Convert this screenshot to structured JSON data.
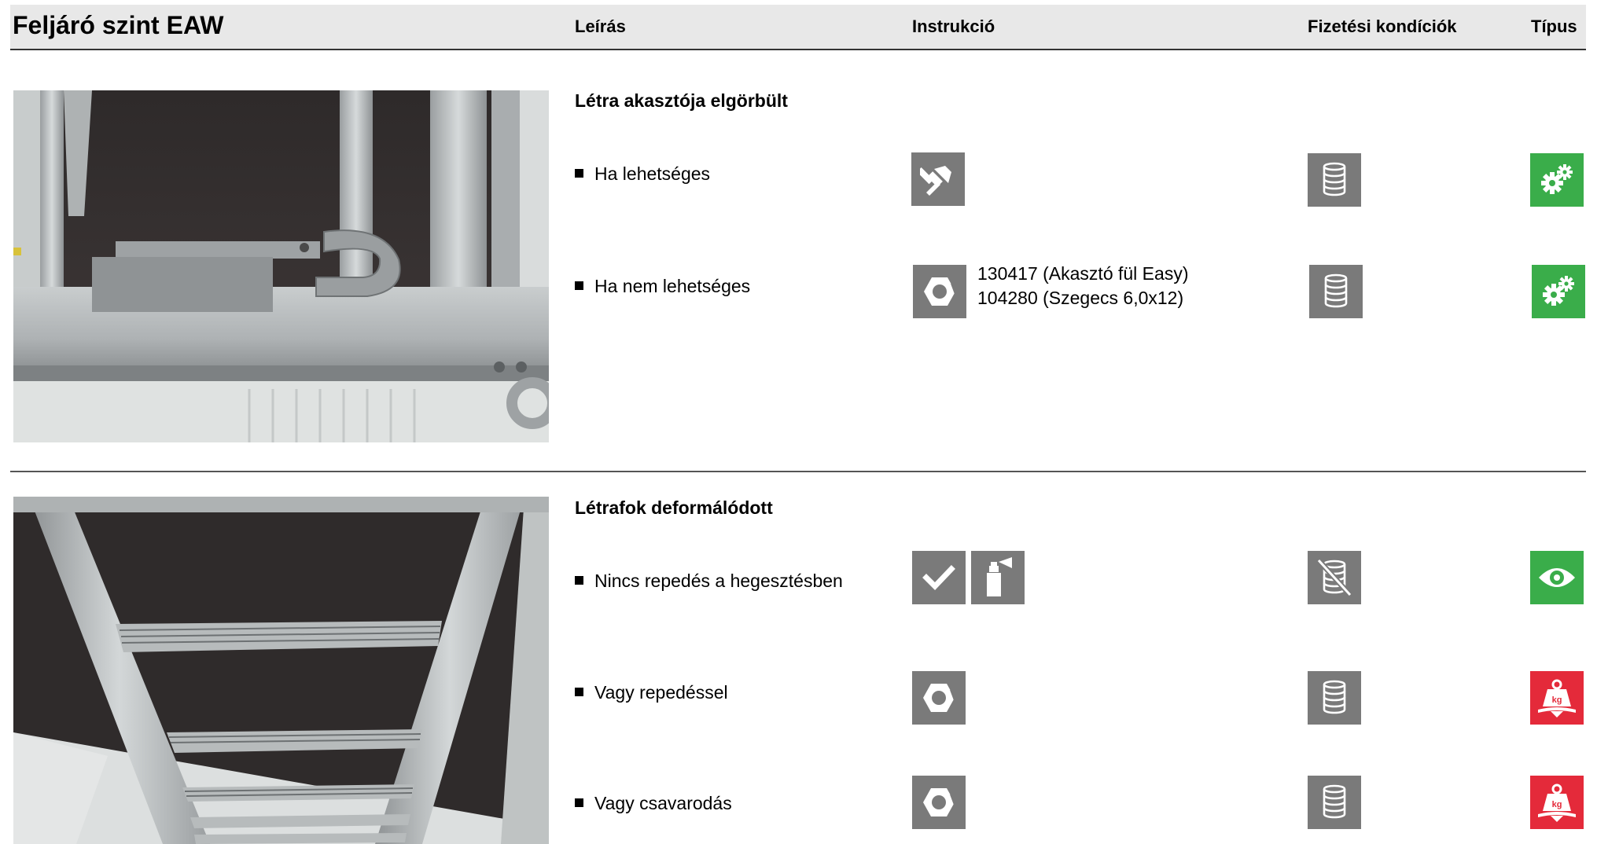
{
  "header": {
    "title": "Feljáró szint EAW",
    "col_description": "Leírás",
    "col_instruction": "Instrukció",
    "col_payment": "Fizetési kondíciók",
    "col_type": "Típus"
  },
  "sections": [
    {
      "title": "Létra akasztója elgörbült",
      "items": [
        {
          "label": "Ha lehetséges",
          "instruction_icons": [
            "hammer-icon"
          ],
          "payment_icon": "coin-stack-icon",
          "type_icon": "gears-icon",
          "type_color": "#3aad4a"
        },
        {
          "label": "Ha nem lehetséges",
          "instruction_icons": [
            "nut-icon"
          ],
          "parts": [
            "130417 (Akasztó fül Easy)",
            "104280 (Szegecs 6,0x12)"
          ],
          "payment_icon": "coin-stack-icon",
          "type_icon": "gears-icon",
          "type_color": "#3aad4a"
        }
      ]
    },
    {
      "title": "Létrafok deformálódott",
      "items": [
        {
          "label": "Nincs repedés a hegesztésben",
          "instruction_icons": [
            "checkmark-icon",
            "spray-can-icon"
          ],
          "payment_icon": "coin-stack-crossed-icon",
          "type_icon": "eye-icon",
          "type_color": "#3aad4a"
        },
        {
          "label": "Vagy repedéssel",
          "instruction_icons": [
            "nut-icon"
          ],
          "payment_icon": "coin-stack-icon",
          "type_icon": "weight-kg-icon",
          "type_color": "#e42a3a"
        },
        {
          "label": "Vagy csavarodás",
          "instruction_icons": [
            "nut-icon"
          ],
          "payment_icon": "coin-stack-icon",
          "type_icon": "weight-kg-icon",
          "type_color": "#e42a3a"
        }
      ]
    }
  ],
  "weight_label": "kg"
}
